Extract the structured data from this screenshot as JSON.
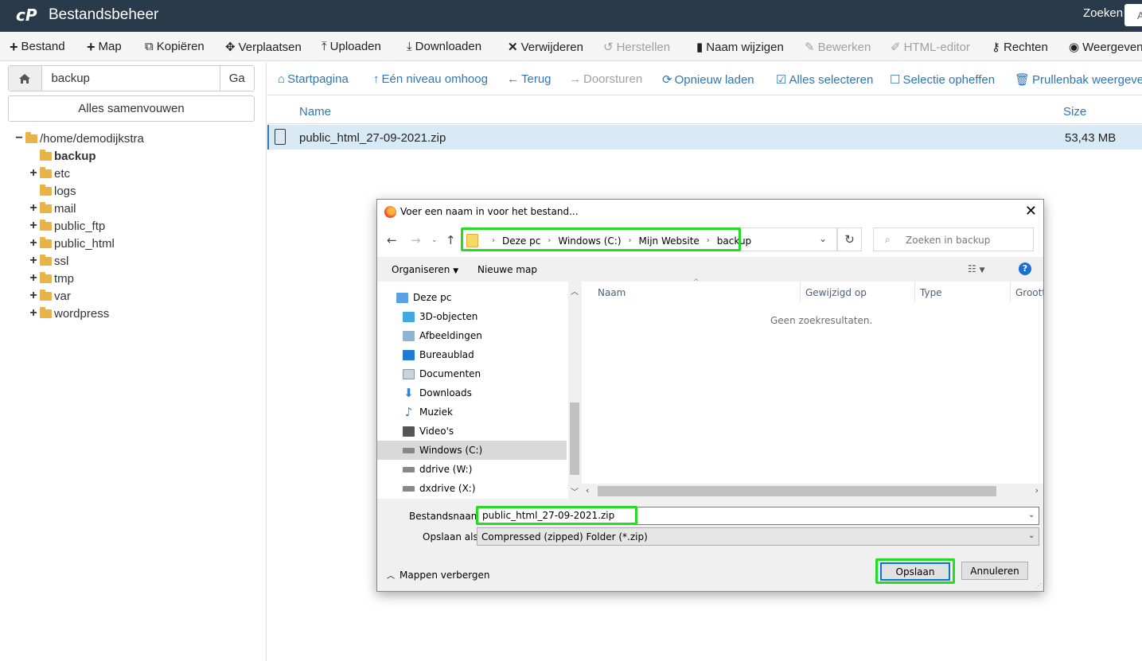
{
  "header": {
    "title": "Bestandsbeheer",
    "search_label": "Zoeken",
    "search_value": "A"
  },
  "toolbar": [
    {
      "label": "Bestand",
      "icon": "plus-icon",
      "disabled": false
    },
    {
      "label": "Map",
      "icon": "plus-icon",
      "disabled": false
    },
    {
      "label": "Kopiëren",
      "icon": "copy-icon",
      "disabled": false
    },
    {
      "label": "Verplaatsen",
      "icon": "move-icon",
      "disabled": false
    },
    {
      "label": "Uploaden",
      "icon": "upload-icon",
      "disabled": false
    },
    {
      "label": "Downloaden",
      "icon": "download-icon",
      "disabled": false
    },
    {
      "label": "Verwijderen",
      "icon": "times-icon",
      "disabled": false
    },
    {
      "label": "Herstellen",
      "icon": "undo-icon",
      "disabled": true
    },
    {
      "label": "Naam wijzigen",
      "icon": "file-icon",
      "disabled": false
    },
    {
      "label": "Bewerken",
      "icon": "pencil-icon",
      "disabled": true
    },
    {
      "label": "HTML-editor",
      "icon": "edit-icon",
      "disabled": true
    },
    {
      "label": "Rechten",
      "icon": "key-icon",
      "disabled": false
    },
    {
      "label": "Weergeven",
      "icon": "eye-icon",
      "disabled": false
    }
  ],
  "left": {
    "path_value": "backup",
    "go_label": "Ga",
    "collapse_label": "Alles samenvouwen",
    "tree": [
      {
        "label": "/home/demodijkstra",
        "sign": "−",
        "open": true
      },
      {
        "label": "backup",
        "sign": "",
        "bold": true
      },
      {
        "label": "etc",
        "sign": "+"
      },
      {
        "label": "logs",
        "sign": ""
      },
      {
        "label": "mail",
        "sign": "+"
      },
      {
        "label": "public_ftp",
        "sign": "+"
      },
      {
        "label": "public_html",
        "sign": "+"
      },
      {
        "label": "ssl",
        "sign": "+"
      },
      {
        "label": "tmp",
        "sign": "+"
      },
      {
        "label": "var",
        "sign": "+"
      },
      {
        "label": "wordpress",
        "sign": "+"
      }
    ]
  },
  "nav": [
    {
      "label": "Startpagina",
      "icon": "home-icon",
      "disabled": false
    },
    {
      "label": "Eén niveau omhoog",
      "icon": "level-up-icon",
      "disabled": false
    },
    {
      "label": "Terug",
      "icon": "arrow-left-icon",
      "disabled": false
    },
    {
      "label": "Doorsturen",
      "icon": "arrow-right-icon",
      "disabled": true
    },
    {
      "label": "Opnieuw laden",
      "icon": "refresh-icon",
      "disabled": false
    },
    {
      "label": "Alles selecteren",
      "icon": "check-square-icon",
      "disabled": false
    },
    {
      "label": "Selectie opheffen",
      "icon": "square-icon",
      "disabled": false
    },
    {
      "label": "Prullenbak weergeven",
      "icon": "trash-icon",
      "disabled": false
    }
  ],
  "files": {
    "columns": {
      "name": "Name",
      "size": "Size"
    },
    "rows": [
      {
        "name": "public_html_27-09-2021.zip",
        "size": "53,43 MB"
      }
    ]
  },
  "dialog": {
    "title": "Voer een naam in voor het bestand...",
    "breadcrumb": [
      "Deze pc",
      "Windows (C:)",
      "Mijn Website",
      "backup"
    ],
    "search_placeholder": "Zoeken in backup",
    "organize_label": "Organiseren",
    "new_folder_label": "Nieuwe map",
    "nav_items": [
      {
        "label": "Deze pc",
        "icon": "computer-icon",
        "color": "#5aa0e6"
      },
      {
        "label": "3D-objecten",
        "icon": "cube-icon",
        "color": "#3fa9e0"
      },
      {
        "label": "Afbeeldingen",
        "icon": "pictures-icon",
        "color": "#8fb3d1"
      },
      {
        "label": "Bureaublad",
        "icon": "desktop-icon",
        "color": "#1f7cd4"
      },
      {
        "label": "Documenten",
        "icon": "documents-icon",
        "color": "#c9d3de"
      },
      {
        "label": "Downloads",
        "icon": "downloads-icon",
        "color": "#2f86d8"
      },
      {
        "label": "Muziek",
        "icon": "music-icon",
        "color": "#2f86d8"
      },
      {
        "label": "Video's",
        "icon": "videos-icon",
        "color": "#555555"
      },
      {
        "label": "Windows (C:)",
        "icon": "drive-icon",
        "color": "#888888",
        "selected": true
      },
      {
        "label": "ddrive (W:)",
        "icon": "drive-icon",
        "color": "#888888"
      },
      {
        "label": "dxdrive (X:)",
        "icon": "drive-icon",
        "color": "#888888"
      }
    ],
    "list_columns": [
      "Naam",
      "Gewijzigd op",
      "Type",
      "Grootte"
    ],
    "empty_text": "Geen zoekresultaten.",
    "filename_label": "Bestandsnaam:",
    "filename_value": "public_html_27-09-2021.zip",
    "savetype_label": "Opslaan als:",
    "savetype_value": "Compressed (zipped) Folder (*.zip)",
    "hide_folders_label": "Mappen verbergen",
    "save_label": "Opslaan",
    "cancel_label": "Annuleren"
  },
  "colors": {
    "header_bg": "#293a4a",
    "link": "#3075b5",
    "highlight": "#22dd22",
    "selected_row": "#d9eaf7"
  }
}
